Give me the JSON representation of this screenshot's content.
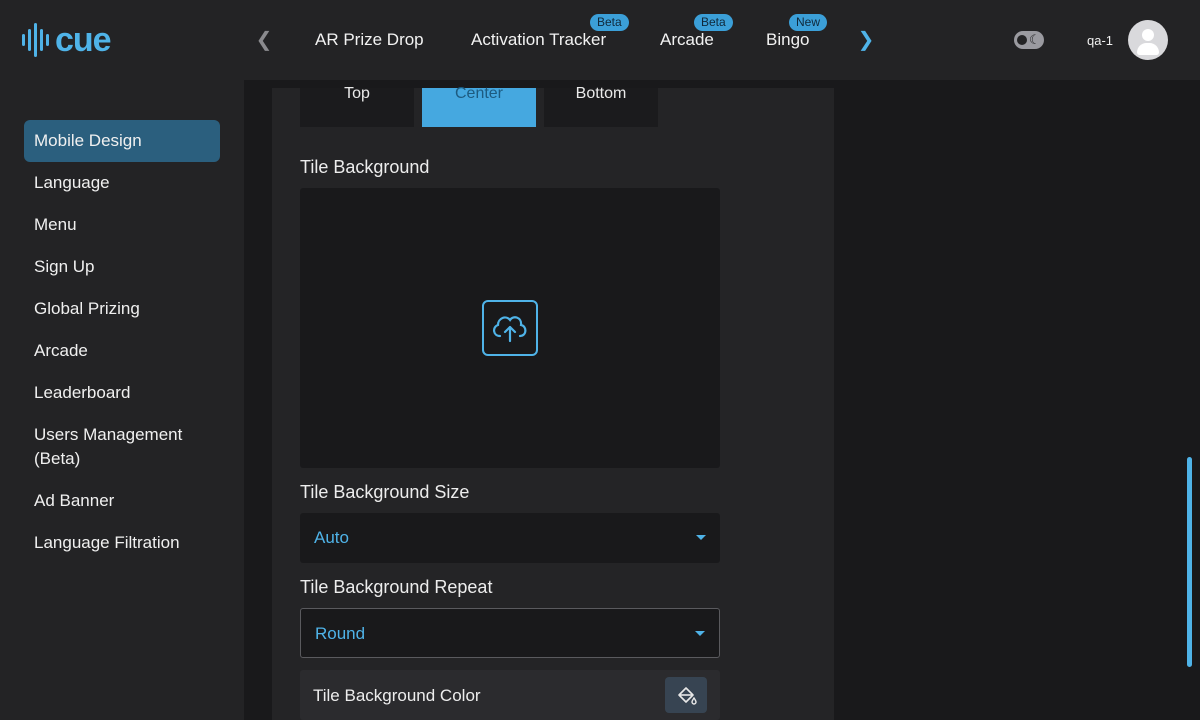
{
  "app": {
    "logo_text": "cue",
    "brand_color": "#4fb3e8"
  },
  "header": {
    "tabs": [
      {
        "label": "AR Prize Drop",
        "badge": ""
      },
      {
        "label": "Activation Tracker",
        "badge": "Beta"
      },
      {
        "label": "Arcade",
        "badge": "Beta"
      },
      {
        "label": "Bingo",
        "badge": "New"
      }
    ],
    "user_name": "qa-1"
  },
  "sidebar": {
    "items": [
      {
        "label": "Mobile Design",
        "active": true
      },
      {
        "label": "Language"
      },
      {
        "label": "Menu"
      },
      {
        "label": "Sign Up"
      },
      {
        "label": "Global Prizing"
      },
      {
        "label": "Arcade"
      },
      {
        "label": "Leaderboard"
      },
      {
        "label": "Users Management (Beta)"
      },
      {
        "label": "Ad Banner"
      },
      {
        "label": "Language Filtration"
      }
    ]
  },
  "main": {
    "position_options": [
      "Top",
      "Center",
      "Bottom"
    ],
    "position_selected": "Center",
    "tile_background_label": "Tile Background",
    "tile_background_size_label": "Tile Background Size",
    "tile_background_size_value": "Auto",
    "tile_background_repeat_label": "Tile Background Repeat",
    "tile_background_repeat_value": "Round",
    "tile_background_color_label": "Tile Background Color"
  },
  "icons": {
    "upload": "cloud-upload-icon",
    "paint": "paint-bucket-icon",
    "theme": "moon-icon",
    "avatar": "user-icon"
  }
}
